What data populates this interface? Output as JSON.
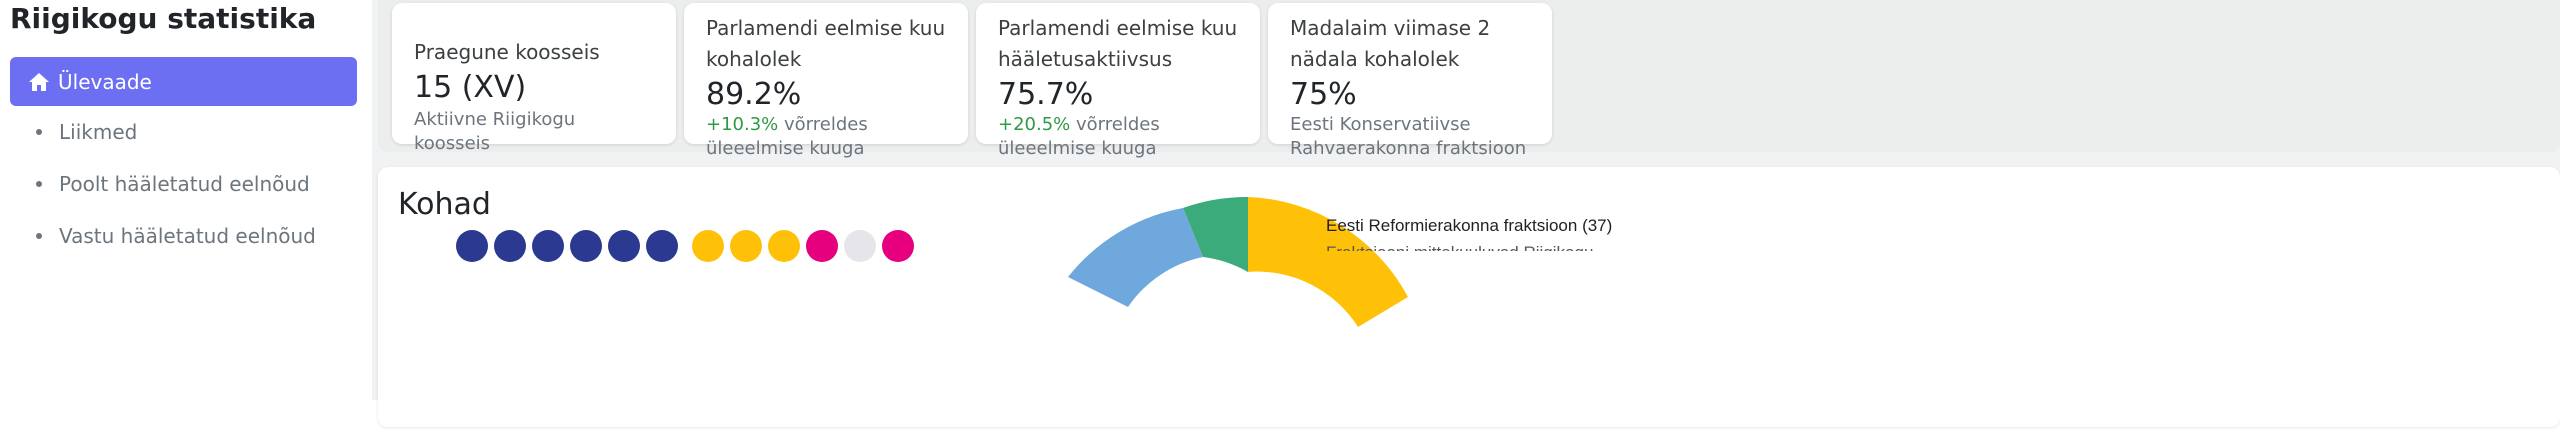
{
  "sidebar": {
    "brand": "Riigikogu statistika",
    "active_item": "Ülevaade",
    "items": [
      {
        "label": "Liikmed"
      },
      {
        "label": "Poolt hääletatud eelnõud"
      },
      {
        "label": "Vastu hääletatud eelnõud"
      }
    ]
  },
  "stats": [
    {
      "title": "Praegune koosseis",
      "value": "15 (XV)",
      "sub": "Aktiivne Riigikogu koosseis"
    },
    {
      "title": "Parlamendi eelmise kuu kohalolek",
      "value": "89.2%",
      "change": "+10.3%",
      "sub": " võrreldes üleeelmise kuuga"
    },
    {
      "title": "Parlamendi eelmise kuu hääletusaktiivsus",
      "value": "75.7%",
      "change": "+20.5%",
      "sub": " võrreldes üleeelmise kuuga"
    },
    {
      "title": "Madalaim viimase 2 nädala kohalolek",
      "value": "75%",
      "sub": "Eesti Konservatiivse Rahvaerakonna fraktsioon"
    }
  ],
  "seats": {
    "title": "Kohad",
    "legend": [
      {
        "label": "Eesti Reformierakonna fraktsioon (37)",
        "color": "#ffc107"
      },
      {
        "label": "Fraktsiooni mittekuuluvad Riigikogu",
        "color": "#6fa8dc"
      }
    ],
    "row_colors": [
      "#2b3990",
      "#2b3990",
      "#2b3990",
      "#2b3990",
      "#2b3990",
      "#2b3990",
      "#ffc107",
      "#ffc107",
      "#ffc107",
      "#e6007e",
      "#e5e5ea",
      "#e6007e"
    ]
  }
}
